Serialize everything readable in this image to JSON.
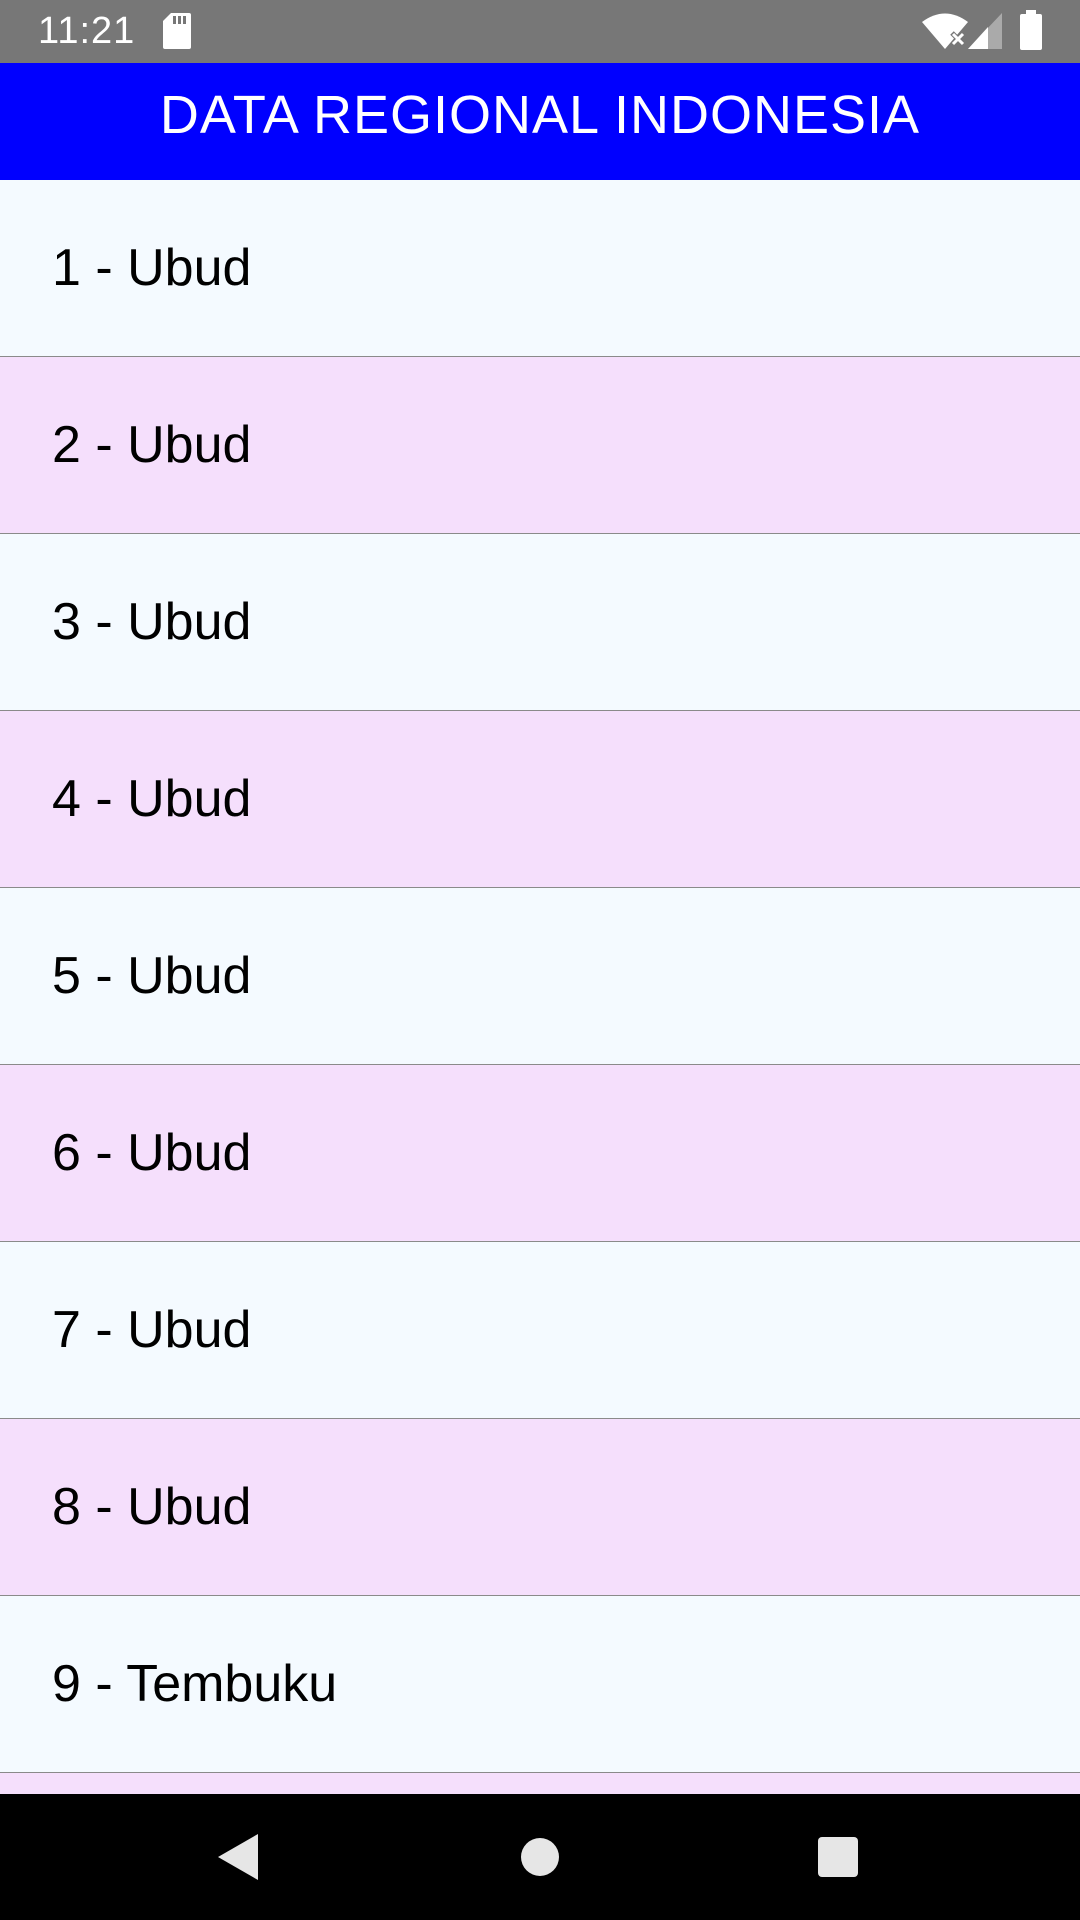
{
  "status_bar": {
    "time": "11:21",
    "icons": [
      "sd-card-icon",
      "wifi-off-icon",
      "cell-signal-icon",
      "battery-icon"
    ]
  },
  "header": {
    "title": "DATA REGIONAL INDONESIA",
    "background_color": "#0000ff"
  },
  "list": {
    "row_colors": [
      "#f4faff",
      "#f5dffc"
    ],
    "items": [
      {
        "label": "1 - Ubud"
      },
      {
        "label": "2 - Ubud"
      },
      {
        "label": "3 - Ubud"
      },
      {
        "label": "4 - Ubud"
      },
      {
        "label": "5 - Ubud"
      },
      {
        "label": "6 - Ubud"
      },
      {
        "label": "7 - Ubud"
      },
      {
        "label": "8 - Ubud"
      },
      {
        "label": "9 - Tembuku"
      },
      {
        "label": ""
      }
    ]
  },
  "nav_bar": {
    "buttons": [
      "back-icon",
      "home-icon",
      "recents-icon"
    ]
  }
}
